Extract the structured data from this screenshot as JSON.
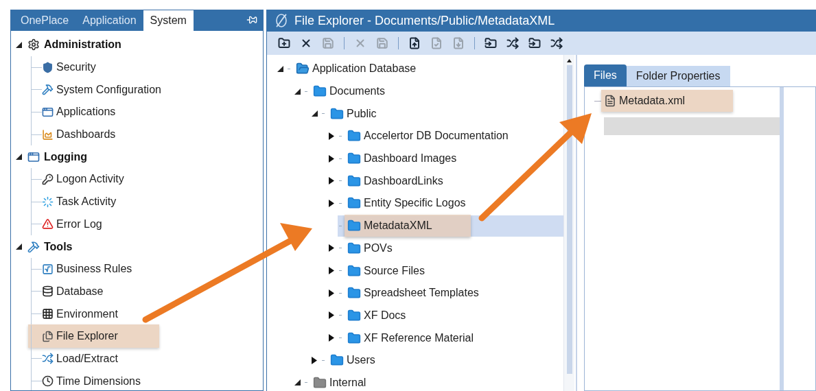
{
  "sidebar": {
    "tabs": [
      {
        "label": "OnePlace",
        "selected": false
      },
      {
        "label": "Application",
        "selected": false
      },
      {
        "label": "System",
        "selected": true
      }
    ],
    "groups": [
      {
        "label": "Administration",
        "kind": "gears",
        "expanded": true,
        "children": [
          {
            "label": "Security",
            "kind": "shield",
            "highlighted": false
          },
          {
            "label": "System Configuration",
            "kind": "hammer",
            "highlighted": false
          },
          {
            "label": "Applications",
            "kind": "window",
            "highlighted": false
          },
          {
            "label": "Dashboards",
            "kind": "chart",
            "highlighted": false
          }
        ]
      },
      {
        "label": "Logging",
        "kind": "window",
        "expanded": true,
        "children": [
          {
            "label": "Logon Activity",
            "kind": "key",
            "highlighted": false
          },
          {
            "label": "Task Activity",
            "kind": "spinner",
            "highlighted": false
          },
          {
            "label": "Error Log",
            "kind": "warning",
            "highlighted": false
          }
        ]
      },
      {
        "label": "Tools",
        "kind": "hammer",
        "expanded": true,
        "children": [
          {
            "label": "Business Rules",
            "kind": "formula",
            "highlighted": false
          },
          {
            "label": "Database",
            "kind": "database",
            "highlighted": false
          },
          {
            "label": "Environment",
            "kind": "grid",
            "highlighted": false
          },
          {
            "label": "File Explorer",
            "kind": "files",
            "highlighted": true
          },
          {
            "label": "Load/Extract",
            "kind": "shuffle",
            "highlighted": false
          },
          {
            "label": "Time Dimensions",
            "kind": "clock",
            "highlighted": false
          }
        ]
      }
    ]
  },
  "explorer": {
    "title": "File Explorer - Documents/Public/MetadataXML",
    "toolbar": [
      {
        "kind": "new-folder",
        "disabled": false
      },
      {
        "kind": "delete",
        "disabled": false
      },
      {
        "kind": "save",
        "disabled": true
      },
      {
        "kind": "separator"
      },
      {
        "kind": "delete",
        "disabled": true
      },
      {
        "kind": "save",
        "disabled": true
      },
      {
        "kind": "separator"
      },
      {
        "kind": "upload",
        "disabled": false
      },
      {
        "kind": "check",
        "disabled": true
      },
      {
        "kind": "download",
        "disabled": true
      },
      {
        "kind": "separator"
      },
      {
        "kind": "folder-import",
        "disabled": false
      },
      {
        "kind": "shuffle",
        "disabled": false
      },
      {
        "kind": "folder-import",
        "disabled": false
      },
      {
        "kind": "shuffle",
        "disabled": false
      }
    ],
    "tree": [
      {
        "label": "Application Database",
        "kind": "open-folder",
        "expanded": true,
        "selected": false,
        "highlighted": false,
        "children": [
          {
            "label": "Documents",
            "kind": "folder",
            "expanded": true,
            "selected": false,
            "highlighted": false,
            "children": [
              {
                "label": "Public",
                "kind": "folder",
                "expanded": true,
                "selected": false,
                "highlighted": false,
                "children": [
                  {
                    "label": "Accelertor DB Documentation",
                    "kind": "folder",
                    "expanded": false,
                    "selected": false,
                    "highlighted": false
                  },
                  {
                    "label": "Dashboard Images",
                    "kind": "folder",
                    "expanded": false,
                    "selected": false,
                    "highlighted": false
                  },
                  {
                    "label": "DashboardLinks",
                    "kind": "folder",
                    "expanded": false,
                    "selected": false,
                    "highlighted": false
                  },
                  {
                    "label": "Entity Specific Logos",
                    "kind": "folder",
                    "expanded": false,
                    "selected": false,
                    "highlighted": false
                  },
                  {
                    "label": "MetadataXML",
                    "kind": "folder",
                    "selected": true,
                    "highlighted": true
                  },
                  {
                    "label": "POVs",
                    "kind": "folder",
                    "expanded": false,
                    "selected": false,
                    "highlighted": false
                  },
                  {
                    "label": "Source Files",
                    "kind": "folder",
                    "expanded": false,
                    "selected": false,
                    "highlighted": false
                  },
                  {
                    "label": "Spreadsheet Templates",
                    "kind": "folder",
                    "expanded": false,
                    "selected": false,
                    "highlighted": false
                  },
                  {
                    "label": "XF Docs",
                    "kind": "folder",
                    "expanded": false,
                    "selected": false,
                    "highlighted": false
                  },
                  {
                    "label": "XF Reference Material",
                    "kind": "folder",
                    "expanded": false,
                    "selected": false,
                    "highlighted": false
                  }
                ]
              },
              {
                "label": "Users",
                "kind": "folder",
                "expanded": false,
                "selected": false,
                "highlighted": false
              }
            ]
          },
          {
            "label": "Internal",
            "kind": "grey-folder",
            "expanded": true,
            "selected": false,
            "highlighted": false
          }
        ]
      }
    ],
    "tabs": [
      {
        "label": "Files",
        "selected": true
      },
      {
        "label": "Folder Properties",
        "selected": false
      }
    ],
    "files": [
      {
        "name": "Metadata.xml",
        "highlighted": true
      }
    ]
  }
}
